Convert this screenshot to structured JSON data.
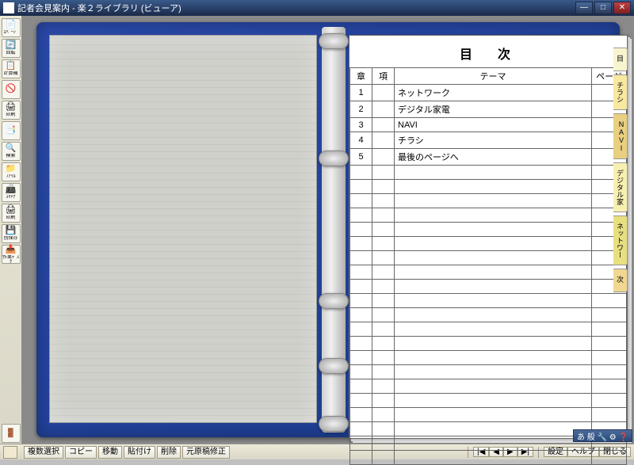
{
  "window": {
    "title": "記者会見案内 - 楽２ライブラリ (ビューア)"
  },
  "sidebar": {
    "tools": [
      {
        "icon": "📄",
        "label": "1ﾍﾟｰｼﾞ"
      },
      {
        "icon": "🔄",
        "label": "回転"
      },
      {
        "icon": "📋",
        "label": "計算機"
      },
      {
        "icon": "🚫",
        "label": ""
      },
      {
        "icon": "🖨",
        "label": "印刷"
      },
      {
        "icon": "📑",
        "label": ""
      },
      {
        "icon": "🔍",
        "label": "検索"
      },
      {
        "icon": "📁",
        "label": "ﾌｧｲﾙ"
      },
      {
        "icon": "📠",
        "label": "ｽｷｬﾅ"
      },
      {
        "icon": "🖨",
        "label": "印刷"
      },
      {
        "icon": "💾",
        "label": "別保存"
      },
      {
        "icon": "📥",
        "label": "作業ﾃﾞｽｸ"
      }
    ],
    "exit": {
      "icon": "🚪",
      "label": ""
    }
  },
  "toc": {
    "title": "目　次",
    "headers": {
      "chapter": "章",
      "section": "項",
      "theme": "テーマ",
      "page": "ページ"
    },
    "rows": [
      {
        "ch": "1",
        "sec": "",
        "theme": "ネットワーク",
        "page": ""
      },
      {
        "ch": "2",
        "sec": "",
        "theme": "デジタル家電",
        "page": ""
      },
      {
        "ch": "3",
        "sec": "",
        "theme": "NAVI",
        "page": ""
      },
      {
        "ch": "4",
        "sec": "",
        "theme": "チラシ",
        "page": ""
      },
      {
        "ch": "5",
        "sec": "",
        "theme": "最後のページへ",
        "page": ""
      }
    ],
    "empty_rows": 21
  },
  "tabs": [
    "目",
    "チラシ",
    "NAVI",
    "デジタル家",
    "ネットワー",
    "次"
  ],
  "bottombar": {
    "buttons": [
      "複数選択",
      "コピー",
      "移動",
      "貼付け",
      "削除",
      "元原稿修正"
    ],
    "nav": [
      "|◀",
      "◀",
      "▶",
      "▶|"
    ],
    "right": [
      "設定",
      "ヘルプ",
      "閉じる"
    ]
  },
  "ime": "あ 般 🔧 ⚙ ❓"
}
